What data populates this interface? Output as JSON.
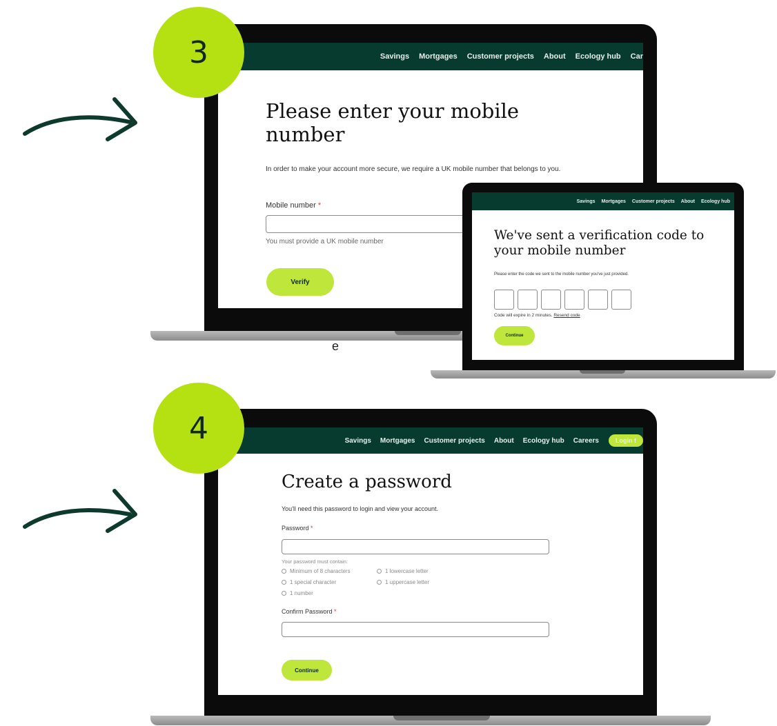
{
  "stray_text": "e",
  "steps": [
    {
      "badge": "3",
      "nav": [
        "Savings",
        "Mortgages",
        "Customer projects",
        "About",
        "Ecology hub",
        "Car"
      ],
      "title": "Please enter your mobile number",
      "body": "In order to make your account more secure, we require a UK mobile number that belongs to you.",
      "field_label": "Mobile number",
      "required_mark": "*",
      "input_value": "",
      "hint": "You must provide a UK mobile number",
      "button": "Verify"
    },
    {
      "nav": [
        "Savings",
        "Mortgages",
        "Customer projects",
        "About",
        "Ecology hub"
      ],
      "title": "We've sent a verification code to your mobile number",
      "body": "Please enter the code we sent to the mobile number you've just provided.",
      "code_digits": [
        "",
        "",
        "",
        "",
        "",
        ""
      ],
      "expiry": "Code will expire in 2 minutes.",
      "resend": "Resend code",
      "button": "Continue"
    },
    {
      "badge": "4",
      "nav": [
        "Savings",
        "Mortgages",
        "Customer projects",
        "About",
        "Ecology hub",
        "Careers"
      ],
      "login": "Login t",
      "title": "Create a password",
      "body": "You'll need this password to login and view your account.",
      "password_label": "Password",
      "required_mark": "*",
      "password_value": "",
      "rules_title": "Your password must contain:",
      "rules": [
        "Minimum of 8 characters",
        "1 lowercase letter",
        "1 special character",
        "1 uppercase letter",
        "1 number"
      ],
      "confirm_label": "Confirm Password",
      "confirm_value": "",
      "button": "Continue"
    }
  ],
  "colors": {
    "nav_bg": "#073b2f",
    "accent": "#bfe63a",
    "badge": "#b5e113",
    "arrow": "#0d3a2c"
  },
  "icons": [
    "curved-arrow-icon",
    "check-circle-icon"
  ]
}
